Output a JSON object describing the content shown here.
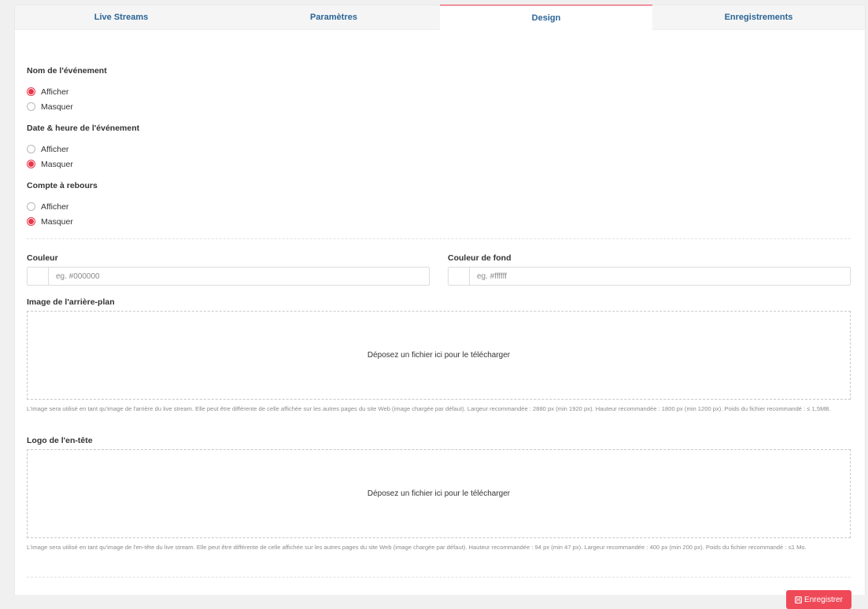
{
  "tabs": [
    {
      "label": "Live Streams"
    },
    {
      "label": "Paramètres"
    },
    {
      "label": "Design"
    },
    {
      "label": "Enregistrements"
    }
  ],
  "active_tab": "Design",
  "event_name": {
    "label": "Nom de l'événement",
    "options": [
      "Afficher",
      "Masquer"
    ],
    "selected": "Afficher"
  },
  "event_datetime": {
    "label": "Date & heure de l'événement",
    "options": [
      "Afficher",
      "Masquer"
    ],
    "selected": "Masquer"
  },
  "countdown": {
    "label": "Compte à rebours",
    "options": [
      "Afficher",
      "Masquer"
    ],
    "selected": "Masquer"
  },
  "color": {
    "label": "Couleur",
    "placeholder": "eg. #000000",
    "value": ""
  },
  "background_color": {
    "label": "Couleur de fond",
    "placeholder": "eg. #ffffff",
    "value": ""
  },
  "background_image": {
    "label": "Image de l'arrière-plan",
    "dropzone_text": "Déposez un fichier ici pour le télécharger",
    "help": "L'image sera utilisé en tant qu'image de l'arrière du live stream. Elle peut être différente de celle affichée sur les autres pages du site Web (image chargée par défaut). Largeur recommandée : 2880 px (min 1920 px). Hauteur recommandée : 1800 px (min 1200 px). Poids du fichier recommandé : ≤ 1,5MB."
  },
  "header_logo": {
    "label": "Logo de l'en-tête",
    "dropzone_text": "Déposez un fichier ici pour le télécharger",
    "help": "L'image sera utilisé en tant qu'image de l'en-tête du live stream. Elle peut être différente de celle affichée sur les autres pages du site Web (image chargée par défaut). Hauteur recommandée : 94 px (min 47 px). Largeur recommandée : 400 px (min 200 px). Poids du fichier recommandé : ≤1 Mo."
  },
  "save_button": {
    "label": "Enregistrer",
    "icon": "save-icon"
  },
  "colors": {
    "accent": "#e8364a",
    "tab_text": "#2a6496",
    "button_bg": "#ef4958"
  }
}
